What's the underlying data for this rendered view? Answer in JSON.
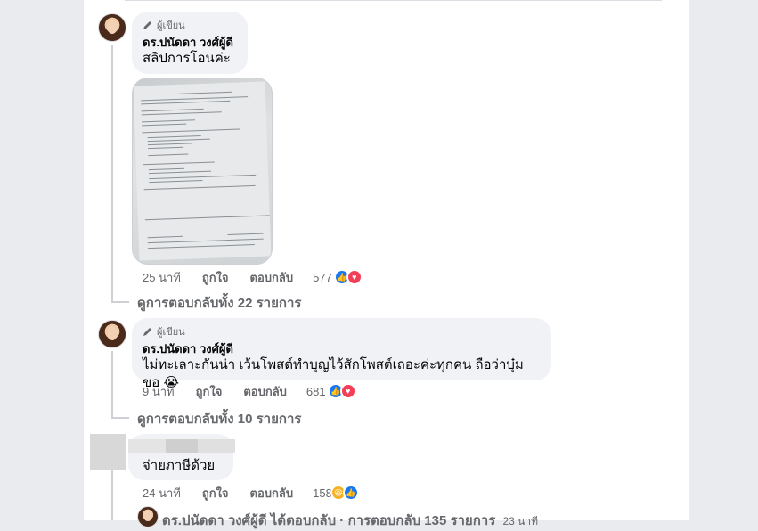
{
  "comments": [
    {
      "badge": "ผู้เขียน",
      "name": "ดร.ปนัดดา วงศ์ผู้ดี",
      "text": "สลิปการโอนค่ะ",
      "time": "25 นาที",
      "like": "ถูกใจ",
      "reply": "ตอบกลับ",
      "reaction_count": "577",
      "reactions": [
        "like-icon",
        "love-icon"
      ],
      "replies": "ดูการตอบกลับทั้ง 22 รายการ"
    },
    {
      "badge": "ผู้เขียน",
      "name": "ดร.ปนัดดา วงศ์ผู้ดี",
      "text": "ไม่ทะเลาะกันน่า เว้นโพสต์ทำบุญไว้สักโพสต์เถอะค่ะทุกคน ถือว่าบุ๋มขอ",
      "emoji": "😭",
      "time": "9 นาที",
      "like": "ถูกใจ",
      "reply": "ตอบกลับ",
      "reaction_count": "681",
      "reactions": [
        "like-icon",
        "love-icon"
      ],
      "replies": "ดูการตอบกลับทั้ง 10 รายการ"
    },
    {
      "text": "จ่ายภาษีด้วย",
      "time": "24 นาที",
      "like": "ถูกใจ",
      "reply": "ตอบกลับ",
      "reaction_count": "158",
      "reactions": [
        "haha-icon",
        "like-icon"
      ]
    }
  ],
  "footer_reply": {
    "text": "ดร.ปนัดดา วงศ์ผู้ดี ได้ตอบกลับ · การตอบกลับ 135 รายการ",
    "time": "23 นาที"
  },
  "colors": {
    "like": "#1877f2",
    "love": "#f33e58",
    "haha": "#f7b125",
    "bubble": "#f0f2f5"
  }
}
